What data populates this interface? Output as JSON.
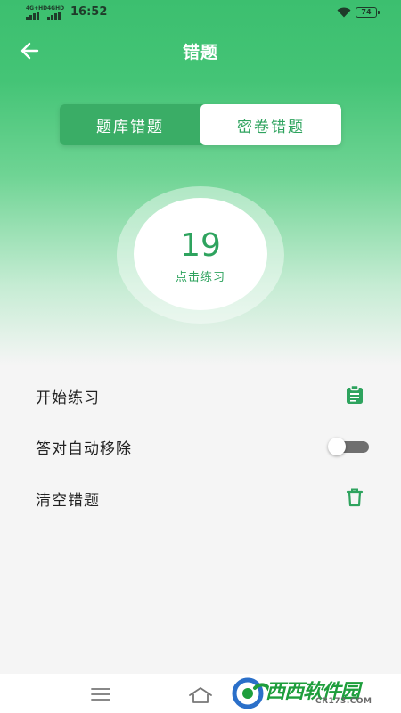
{
  "status_bar": {
    "network_1": "4G+HD",
    "network_2": "4GHD",
    "time": "16:52",
    "battery": "74"
  },
  "header": {
    "title": "错题",
    "back_icon": "arrow-left-icon"
  },
  "tabs": [
    {
      "label": "题库错题",
      "active": false
    },
    {
      "label": "密卷错题",
      "active": true
    }
  ],
  "summary": {
    "count": "19",
    "action_label": "点击练习"
  },
  "menu": [
    {
      "label": "开始练习",
      "icon": "clipboard-icon"
    },
    {
      "label": "答对自动移除",
      "control": "toggle",
      "toggle_on": false
    },
    {
      "label": "清空错题",
      "icon": "trash-icon"
    }
  ],
  "nav": {
    "menu_icon": "hamburger-icon",
    "home_icon": "home-icon"
  },
  "watermark": {
    "name": "西西软件园",
    "url": "CR173.COM"
  },
  "colors": {
    "primary": "#3cbf6f",
    "accent_text": "#2ea35e",
    "background": "#f5f5f5"
  }
}
